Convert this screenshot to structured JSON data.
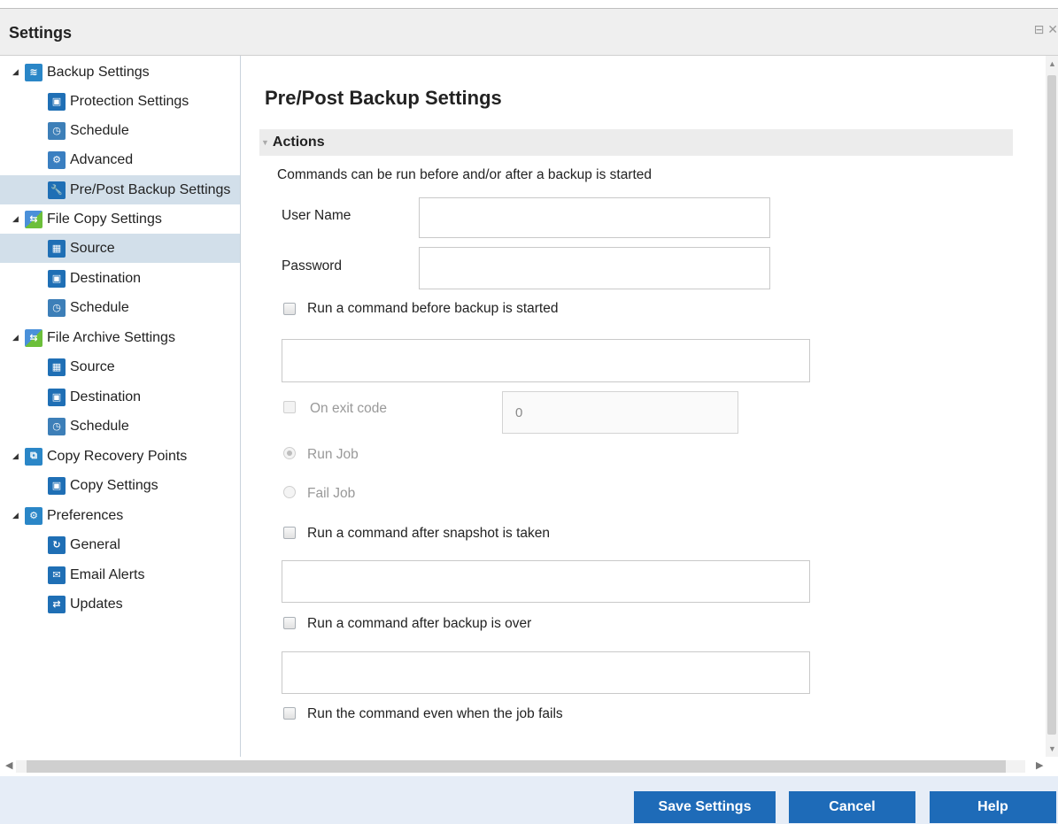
{
  "window": {
    "title": "Settings",
    "controls": "⊟ ✕"
  },
  "sidebar": {
    "items": [
      {
        "label": "Backup Settings",
        "icon": "backup-settings-icon"
      },
      {
        "label": "Protection Settings",
        "icon": "protection-settings-icon"
      },
      {
        "label": "Schedule",
        "icon": "schedule-icon"
      },
      {
        "label": "Advanced",
        "icon": "advanced-icon"
      },
      {
        "label": "Pre/Post Backup Settings",
        "icon": "wrench-icon"
      },
      {
        "label": "File Copy Settings",
        "icon": "file-copy-icon"
      },
      {
        "label": "Source",
        "icon": "source-icon"
      },
      {
        "label": "Destination",
        "icon": "destination-icon"
      },
      {
        "label": "Schedule",
        "icon": "schedule-icon"
      },
      {
        "label": "File Archive Settings",
        "icon": "file-archive-icon"
      },
      {
        "label": "Source",
        "icon": "source-icon"
      },
      {
        "label": "Destination",
        "icon": "destination-icon"
      },
      {
        "label": "Schedule",
        "icon": "schedule-icon"
      },
      {
        "label": "Copy Recovery Points",
        "icon": "copy-recovery-icon"
      },
      {
        "label": "Copy Settings",
        "icon": "copy-settings-icon"
      },
      {
        "label": "Preferences",
        "icon": "preferences-icon"
      },
      {
        "label": "General",
        "icon": "general-icon"
      },
      {
        "label": "Email Alerts",
        "icon": "email-icon"
      },
      {
        "label": "Updates",
        "icon": "updates-icon"
      }
    ]
  },
  "main": {
    "title": "Pre/Post Backup Settings",
    "section": "Actions",
    "description": "Commands can be run before and/or after a backup is started",
    "username_label": "User Name",
    "username_value": "",
    "password_label": "Password",
    "password_value": "",
    "before_label": "Run a command before backup is started",
    "before_value": "",
    "exit_code_label": "On exit code",
    "exit_code_value": "0",
    "run_job_label": "Run Job",
    "fail_job_label": "Fail Job",
    "after_snapshot_label": "Run a command after snapshot is taken",
    "after_snapshot_value": "",
    "after_backup_label": "Run a command after backup is over",
    "after_backup_value": "",
    "even_fail_label": "Run the command even when the job fails"
  },
  "footer": {
    "save_label": "Save Settings",
    "cancel_label": "Cancel",
    "help_label": "Help"
  },
  "colors": {
    "button": "#1e6bb8",
    "selected_row": "#d2dfea",
    "footer_bg": "#e6edf7"
  }
}
